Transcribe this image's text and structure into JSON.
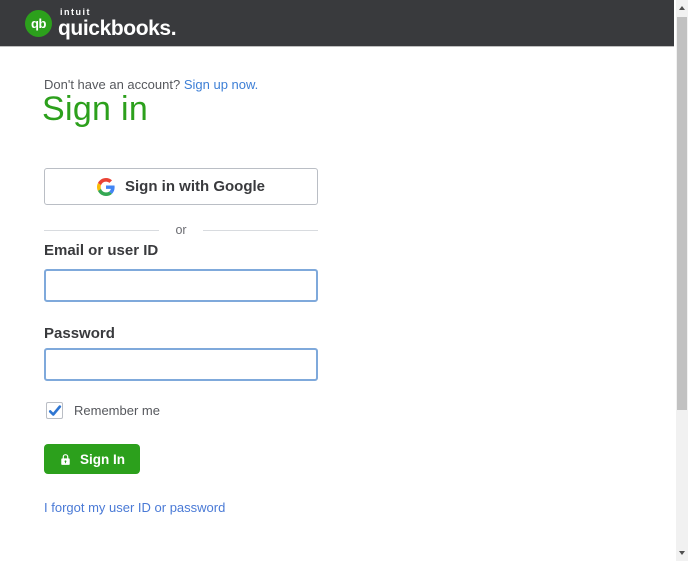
{
  "brand": {
    "monogram": "qb",
    "company": "intuit",
    "product": "quickbooks.",
    "green": "#2CA01C",
    "header_bg": "#393A3D"
  },
  "signup": {
    "prompt": "Don't have an account?",
    "link_label": "Sign up now."
  },
  "heading": "Sign in",
  "google_button": {
    "label": "Sign in with Google"
  },
  "divider_label": "or",
  "form": {
    "email": {
      "label": "Email or user ID",
      "value": "",
      "placeholder": ""
    },
    "password": {
      "label": "Password",
      "value": "",
      "placeholder": ""
    },
    "remember": {
      "label": "Remember me",
      "checked": true
    },
    "submit_label": "Sign In",
    "forgot_link_label": "I forgot my user ID or password"
  },
  "colors": {
    "link_blue": "#3D7FD6",
    "input_border_blue": "#7FA9DB",
    "checkbox_check_blue": "#2F76D2",
    "text_dark": "#393A3D",
    "text_muted": "#56585D"
  }
}
